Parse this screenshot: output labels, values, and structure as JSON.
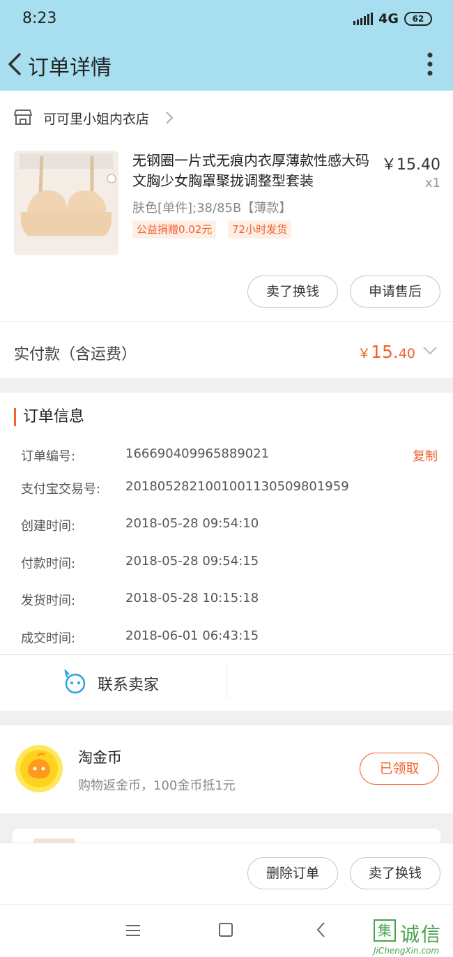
{
  "status": {
    "time": "8:23",
    "network": "4G",
    "battery": "62"
  },
  "nav": {
    "title": "订单详情"
  },
  "shop": {
    "name": "可可里小姐内衣店"
  },
  "product": {
    "title": "无钢圈一片式无痕内衣厚薄款性感大码文胸少女胸罩聚拢调整型套装",
    "price": "￥15.40",
    "qty": "x1",
    "sku": "肤色[单件];38/85B【薄款】",
    "tags": [
      "公益捐赠0.02元",
      "72小时发货"
    ]
  },
  "actions": {
    "sell": "卖了换钱",
    "after_sale": "申请售后"
  },
  "payment": {
    "label": "实付款（含运费）",
    "currency": "￥",
    "integer": "15.",
    "decimal": "40"
  },
  "order_info": {
    "title": "订单信息",
    "copy_label": "复制",
    "rows": [
      {
        "label": "订单编号:",
        "value": "166690409965889021"
      },
      {
        "label": "支付宝交易号:",
        "value": "2018052821001001130509801959"
      },
      {
        "label": "创建时间:",
        "value": "2018-05-28 09:54:10"
      },
      {
        "label": "付款时间:",
        "value": "2018-05-28 09:54:15"
      },
      {
        "label": "发货时间:",
        "value": "2018-05-28 10:15:18"
      },
      {
        "label": "成交时间:",
        "value": "2018-06-01 06:43:15"
      }
    ]
  },
  "contact": {
    "label": "联系卖家"
  },
  "coins": {
    "title": "淘金币",
    "desc": "购物返金币，100金币抵1元",
    "button": "已领取"
  },
  "bottom": {
    "delete": "删除订单",
    "sell": "卖了换钱"
  },
  "watermark": {
    "text": "诚信",
    "box": "集",
    "sub": "JiChengXin.com"
  },
  "colors": {
    "accent": "#f2612a",
    "header": "#a8dff0",
    "link_blue": "#29a3e0"
  }
}
